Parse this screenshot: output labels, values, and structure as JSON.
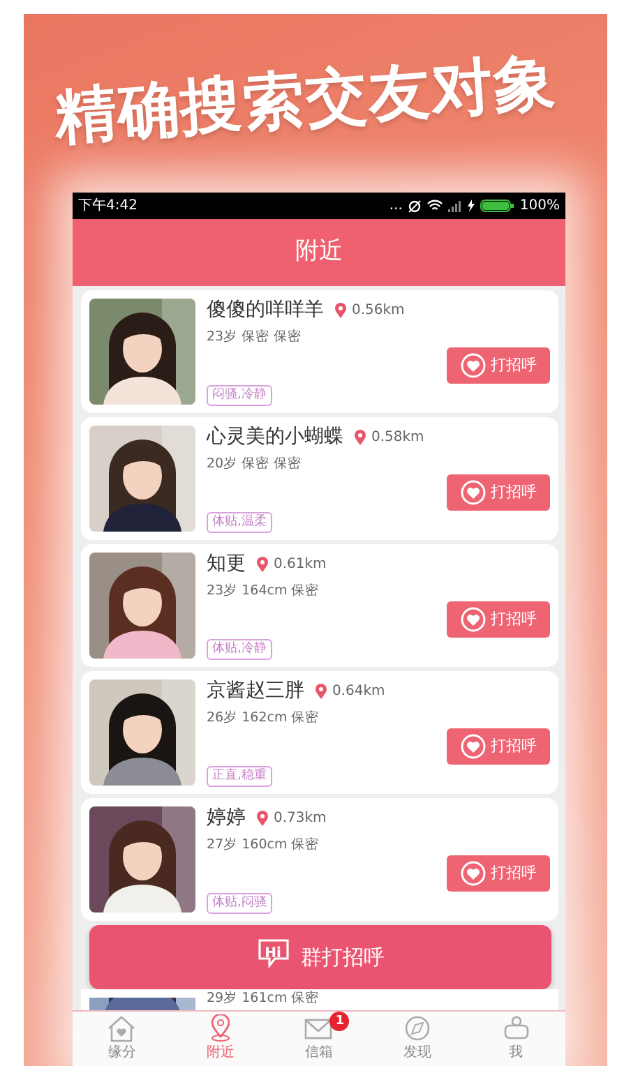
{
  "headline": "精确搜索交友对象",
  "status_bar": {
    "time": "下午4:42",
    "dots": "...",
    "battery": "100%"
  },
  "header": {
    "title": "附近"
  },
  "users": [
    {
      "name": "傻傻的咩咩羊",
      "distance": "0.56km",
      "info": "23岁 保密 保密",
      "tag": "闷骚,冷静",
      "greet": "打招呼"
    },
    {
      "name": "心灵美的小蝴蝶",
      "distance": "0.58km",
      "info": "20岁 保密 保密",
      "tag": "体贴,温柔",
      "greet": "打招呼"
    },
    {
      "name": "知更",
      "distance": "0.61km",
      "info": "23岁 164cm 保密",
      "tag": "体贴,冷静",
      "greet": "打招呼"
    },
    {
      "name": "京酱赵三胖",
      "distance": "0.64km",
      "info": "26岁 162cm 保密",
      "tag": "正直,稳重",
      "greet": "打招呼"
    },
    {
      "name": "婷婷",
      "distance": "0.73km",
      "info": "27岁 160cm 保密",
      "tag": "体贴,闷骚",
      "greet": "打招呼"
    }
  ],
  "partial_user": {
    "info": "29岁 161cm 保密"
  },
  "group_greet": {
    "icon_text": "Hi",
    "label": "群打招呼"
  },
  "tabs": [
    {
      "label": "缘分",
      "selected": false,
      "kind": "home"
    },
    {
      "label": "附近",
      "selected": true,
      "kind": "pin"
    },
    {
      "label": "信箱",
      "selected": false,
      "kind": "mail",
      "badge": "1"
    },
    {
      "label": "发现",
      "selected": false,
      "kind": "compass"
    },
    {
      "label": "我",
      "selected": false,
      "kind": "me"
    }
  ]
}
